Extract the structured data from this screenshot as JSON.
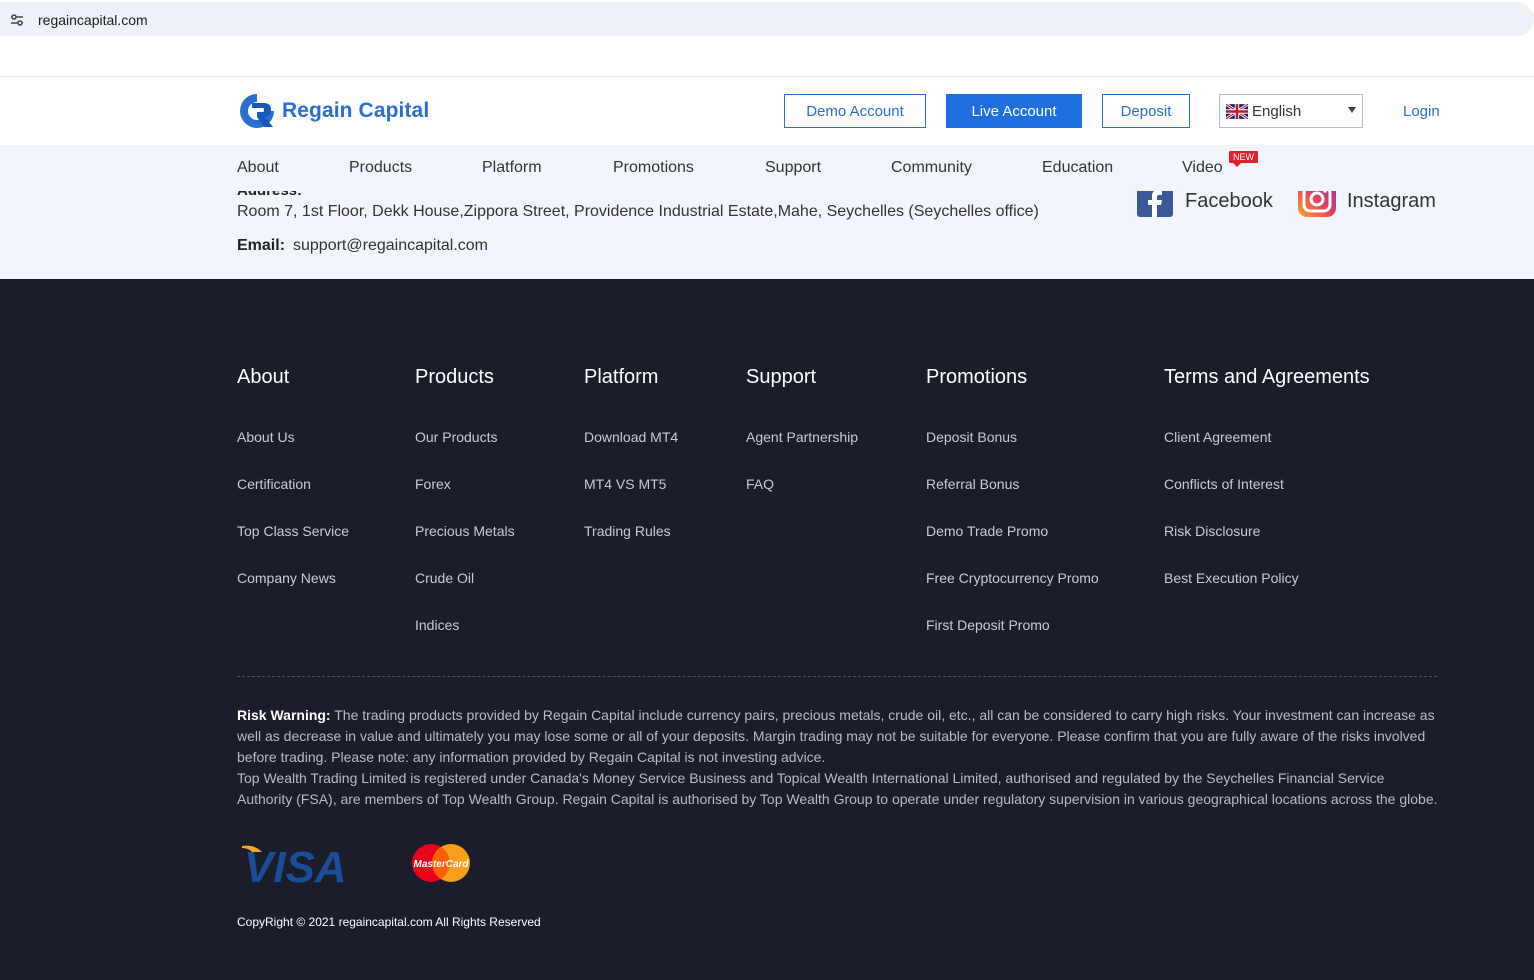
{
  "browser": {
    "url": "regaincapital.com"
  },
  "header": {
    "logo_text": "Regain Capital",
    "demo_label": "Demo Account",
    "live_label": "Live Account",
    "deposit_label": "Deposit",
    "language": "English",
    "login_label": "Login"
  },
  "nav": {
    "items": [
      "About",
      "Products",
      "Platform",
      "Promotions",
      "Support",
      "Community",
      "Education",
      "Video"
    ],
    "badge": "NEW"
  },
  "contact": {
    "address_label": "Address:",
    "address": "Room 7, 1st Floor, Dekk House,Zippora Street, Providence Industrial Estate,Mahe, Seychelles (Seychelles office)",
    "email_label": "Email:",
    "email": "support@regaincapital.com",
    "facebook_label": "Facebook",
    "instagram_label": "Instagram"
  },
  "footer": {
    "columns": [
      {
        "title": "About",
        "links": [
          "About Us",
          "Certification",
          "Top Class Service",
          "Company News"
        ]
      },
      {
        "title": "Products",
        "links": [
          "Our Products",
          "Forex",
          "Precious Metals",
          "Crude Oil",
          "Indices"
        ]
      },
      {
        "title": "Platform",
        "links": [
          "Download MT4",
          "MT4 VS MT5",
          "Trading Rules"
        ]
      },
      {
        "title": "Support",
        "links": [
          "Agent Partnership",
          "FAQ"
        ]
      },
      {
        "title": "Promotions",
        "links": [
          "Deposit Bonus",
          "Referral Bonus",
          "Demo Trade Promo",
          "Free Cryptocurrency Promo",
          "First Deposit Promo"
        ]
      },
      {
        "title": "Terms and Agreements",
        "links": [
          "Client Agreement",
          "Conflicts of Interest",
          "Risk Disclosure",
          "Best Execution Policy"
        ]
      }
    ],
    "risk_label": "Risk Warning:",
    "risk_text": " The trading products provided by Regain Capital include currency pairs, precious metals, crude oil, etc., all can be considered to carry high risks. Your investment can increase as well as decrease in value and ultimately you may lose some or all of your deposits. Margin trading may not be suitable for everyone. Please confirm that you are fully aware of the risks involved before trading. Please note: any information provided by Regain Capital is not investing advice.",
    "regulatory_text": "Top Wealth Trading Limited is registered under Canada's Money Service Business and Topical Wealth International Limited, authorised and regulated by the Seychelles Financial Service Authority (FSA), are members of Top Wealth Group. Regain Capital is authorised by Top Wealth Group to operate under regulatory supervision in various geographical locations across the globe.",
    "visa_text": "VISA",
    "mastercard_text": "MasterCard",
    "copyright": "CopyRight © 2021 regaincapital.com All Rights Reserved"
  },
  "colors": {
    "brand": "#2a6dd3",
    "footer_bg": "#1c1d2b",
    "band_bg": "#f2f5fb",
    "badge": "#e0202b"
  }
}
